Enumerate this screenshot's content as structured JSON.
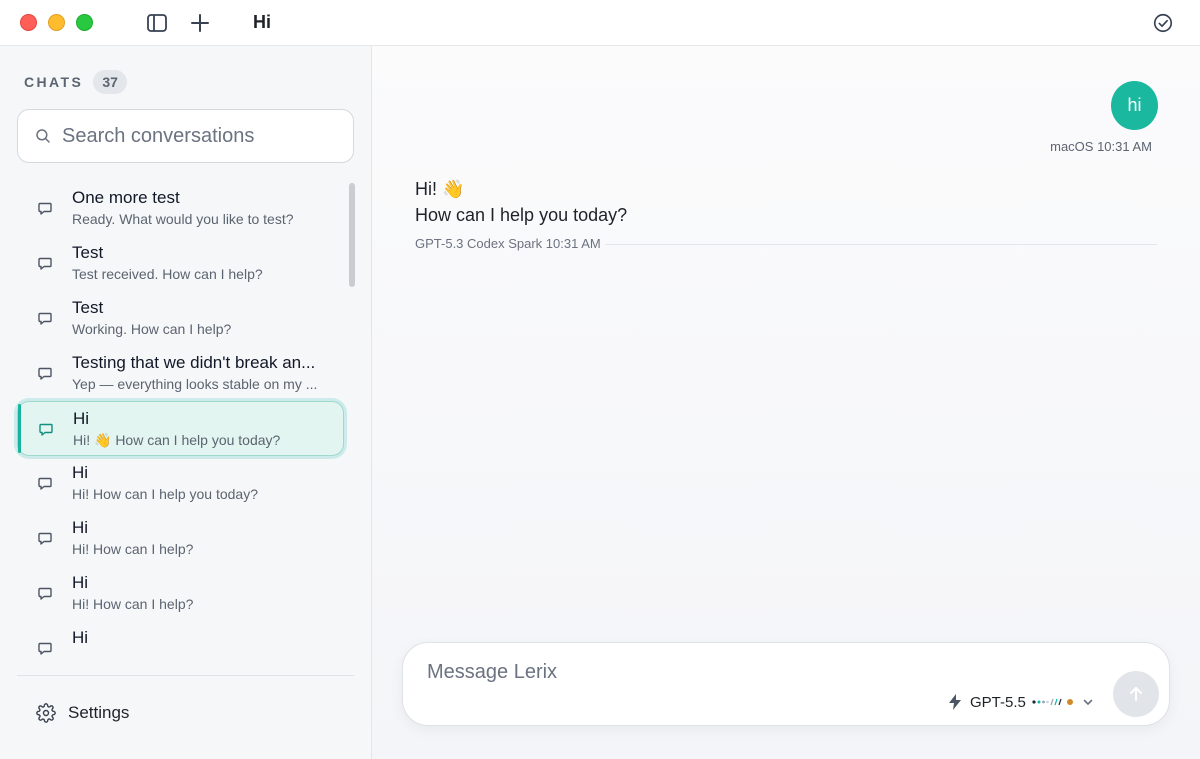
{
  "window": {
    "title": "Hi"
  },
  "sidebar": {
    "chats_label": "CHATS",
    "chats_count": "37",
    "search_placeholder": "Search conversations",
    "conversations": [
      {
        "title": "One more test",
        "preview": "Ready. What would you like to test?",
        "active": false
      },
      {
        "title": "Test",
        "preview": "Test received. How can I help?",
        "active": false
      },
      {
        "title": "Test",
        "preview": "Working. How can I help?",
        "active": false
      },
      {
        "title": "Testing that we didn't break an...",
        "preview": "Yep — everything looks stable on my ...",
        "active": false
      },
      {
        "title": "Hi",
        "preview": "Hi! 👋 How can I help you today?",
        "active": true
      },
      {
        "title": "Hi",
        "preview": "Hi! How can I help you today?",
        "active": false
      },
      {
        "title": "Hi",
        "preview": "Hi! How can I help?",
        "active": false
      },
      {
        "title": "Hi",
        "preview": "Hi! How can I help?",
        "active": false
      },
      {
        "title": "Hi",
        "preview": "",
        "active": false
      }
    ],
    "settings_label": "Settings"
  },
  "conversation": {
    "user_message": "hi",
    "user_meta": "macOS 10:31 AM",
    "assistant_line1": "Hi! 👋",
    "assistant_line2": "How can I help you today?",
    "assistant_meta": "GPT-5.3 Codex Spark 10:31 AM"
  },
  "composer": {
    "placeholder": "Message Lerix",
    "model_name": "GPT-5.5"
  },
  "colors": {
    "accent": "#1bb8a0",
    "active_item_bg": "#e2f5f1",
    "traffic_red": "#ff5f57",
    "traffic_yellow": "#febc2e",
    "traffic_green": "#28c840"
  },
  "icons": {
    "sidebar_toggle": "sidebar-toggle-icon",
    "new_chat": "plus-icon",
    "status": "check-circle-icon",
    "search": "search-icon",
    "conversation": "chat-bubble-icon",
    "settings": "gear-icon",
    "model": "bolt-icon",
    "dropdown": "chevron-down-icon",
    "send": "arrow-up-icon"
  }
}
